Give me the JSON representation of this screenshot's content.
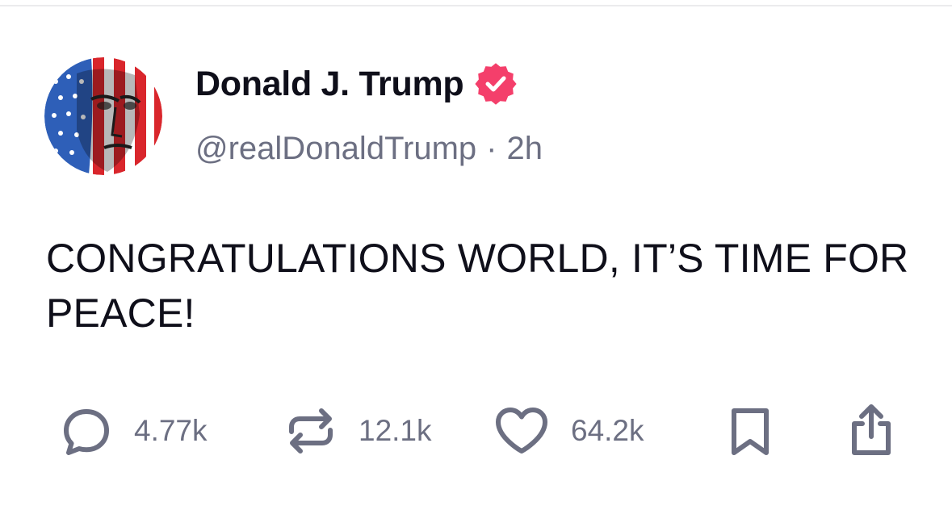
{
  "post": {
    "author": {
      "display_name": "Donald J. Trump",
      "handle": "@realDonaldTrump",
      "verified": true
    },
    "meta_separator": "·",
    "timestamp": "2h",
    "text": "CONGRATULATIONS WORLD, IT’S TIME FOR PEACE!",
    "actions": {
      "replies": "4.77k",
      "retruths": "12.1k",
      "likes": "64.2k"
    }
  },
  "colors": {
    "text_primary": "#0f0f1a",
    "text_secondary": "#6c6f82",
    "verified_badge": "#f43f6b",
    "icon_gray": "#6c6f82"
  },
  "icons": {
    "reply": "speech-bubble-icon",
    "retruth": "repost-arrows-icon",
    "like": "heart-icon",
    "save": "bookmark-icon",
    "share": "share-upload-icon",
    "verified": "verified-badge-icon"
  }
}
